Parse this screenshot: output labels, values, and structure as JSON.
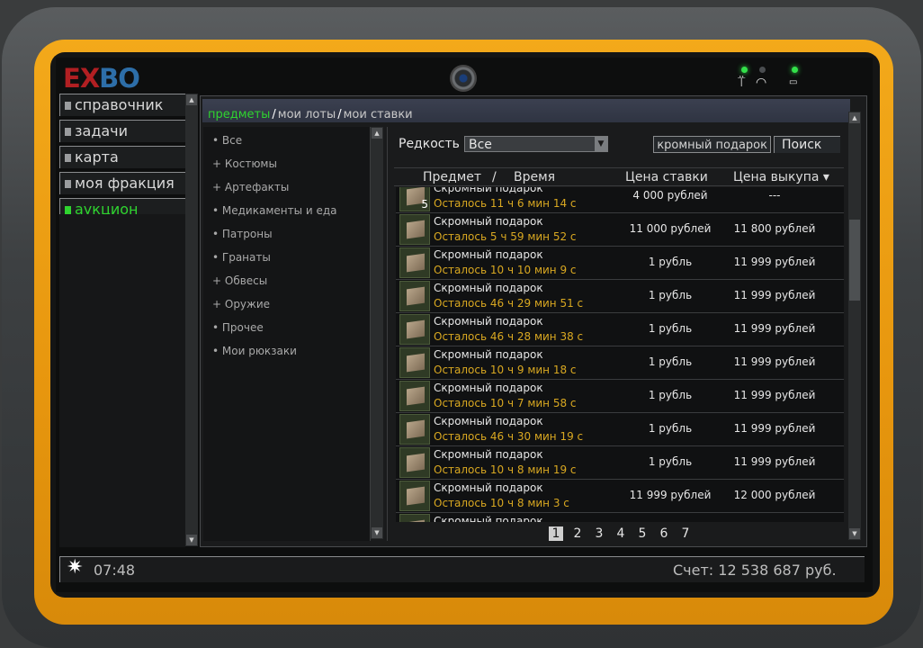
{
  "logo": {
    "part1": "E",
    "part2": "X",
    "part3": "BO"
  },
  "menu": [
    {
      "label": "справочник",
      "active": false
    },
    {
      "label": "задачи",
      "active": false
    },
    {
      "label": "карта",
      "active": false
    },
    {
      "label": "моя фракция",
      "active": false
    },
    {
      "label": "аукцион",
      "active": true
    }
  ],
  "tabs": {
    "items": "предметы",
    "my_lots": "мои лоты",
    "my_bids": "мои ставки"
  },
  "categories": [
    "• Все",
    "+ Костюмы",
    "+ Артефакты",
    "• Медикаменты и еда",
    "• Патроны",
    "• Гранаты",
    "+ Обвесы",
    "+ Оружие",
    "• Прочее",
    "• Мои рюкзаки"
  ],
  "filter": {
    "rarity_label": "Редкость",
    "rarity_value": "Все",
    "search_value": "кромный подарок",
    "search_button": "Поиск"
  },
  "columns": {
    "item": "Предмет",
    "slash": "/",
    "time": "Время",
    "bid": "Цена ставки",
    "buyout": "Цена выкупа ▾"
  },
  "rows": [
    {
      "name": "Скромный подарок",
      "time": "Осталось 11 ч 6 мин 14 с",
      "bid": "4 000 рублей",
      "buyout": "---",
      "qty": "5"
    },
    {
      "name": "Скромный подарок",
      "time": "Осталось 5 ч 59 мин 52 с",
      "bid": "11 000 рублей",
      "buyout": "11 800 рублей",
      "qty": ""
    },
    {
      "name": "Скромный подарок",
      "time": "Осталось 10 ч 10 мин 9 с",
      "bid": "1 рубль",
      "buyout": "11 999 рублей",
      "qty": ""
    },
    {
      "name": "Скромный подарок",
      "time": "Осталось 46 ч 29 мин 51 с",
      "bid": "1 рубль",
      "buyout": "11 999 рублей",
      "qty": ""
    },
    {
      "name": "Скромный подарок",
      "time": "Осталось 46 ч 28 мин 38 с",
      "bid": "1 рубль",
      "buyout": "11 999 рублей",
      "qty": ""
    },
    {
      "name": "Скромный подарок",
      "time": "Осталось 10 ч 9 мин 18 с",
      "bid": "1 рубль",
      "buyout": "11 999 рублей",
      "qty": ""
    },
    {
      "name": "Скромный подарок",
      "time": "Осталось 10 ч 7 мин 58 с",
      "bid": "1 рубль",
      "buyout": "11 999 рублей",
      "qty": ""
    },
    {
      "name": "Скромный подарок",
      "time": "Осталось 46 ч 30 мин 19 с",
      "bid": "1 рубль",
      "buyout": "11 999 рублей",
      "qty": ""
    },
    {
      "name": "Скромный подарок",
      "time": "Осталось 10 ч 8 мин 19 с",
      "bid": "1 рубль",
      "buyout": "11 999 рублей",
      "qty": ""
    },
    {
      "name": "Скромный подарок",
      "time": "Осталось 10 ч 8 мин 3 с",
      "bid": "11 999 рублей",
      "buyout": "12 000 рублей",
      "qty": ""
    },
    {
      "name": "Скромный подарок",
      "time": "",
      "bid": "",
      "buyout": "",
      "qty": ""
    }
  ],
  "pagination": {
    "pages": [
      "1",
      "2",
      "3",
      "4",
      "5",
      "6",
      "7"
    ],
    "current": "1"
  },
  "footer": {
    "time": "07:48",
    "balance": "Счет: 12 538 687 руб."
  },
  "colors": {
    "accent_green": "#2fd42f",
    "time_yellow": "#d9a821",
    "frame_orange": "#e7960e"
  }
}
